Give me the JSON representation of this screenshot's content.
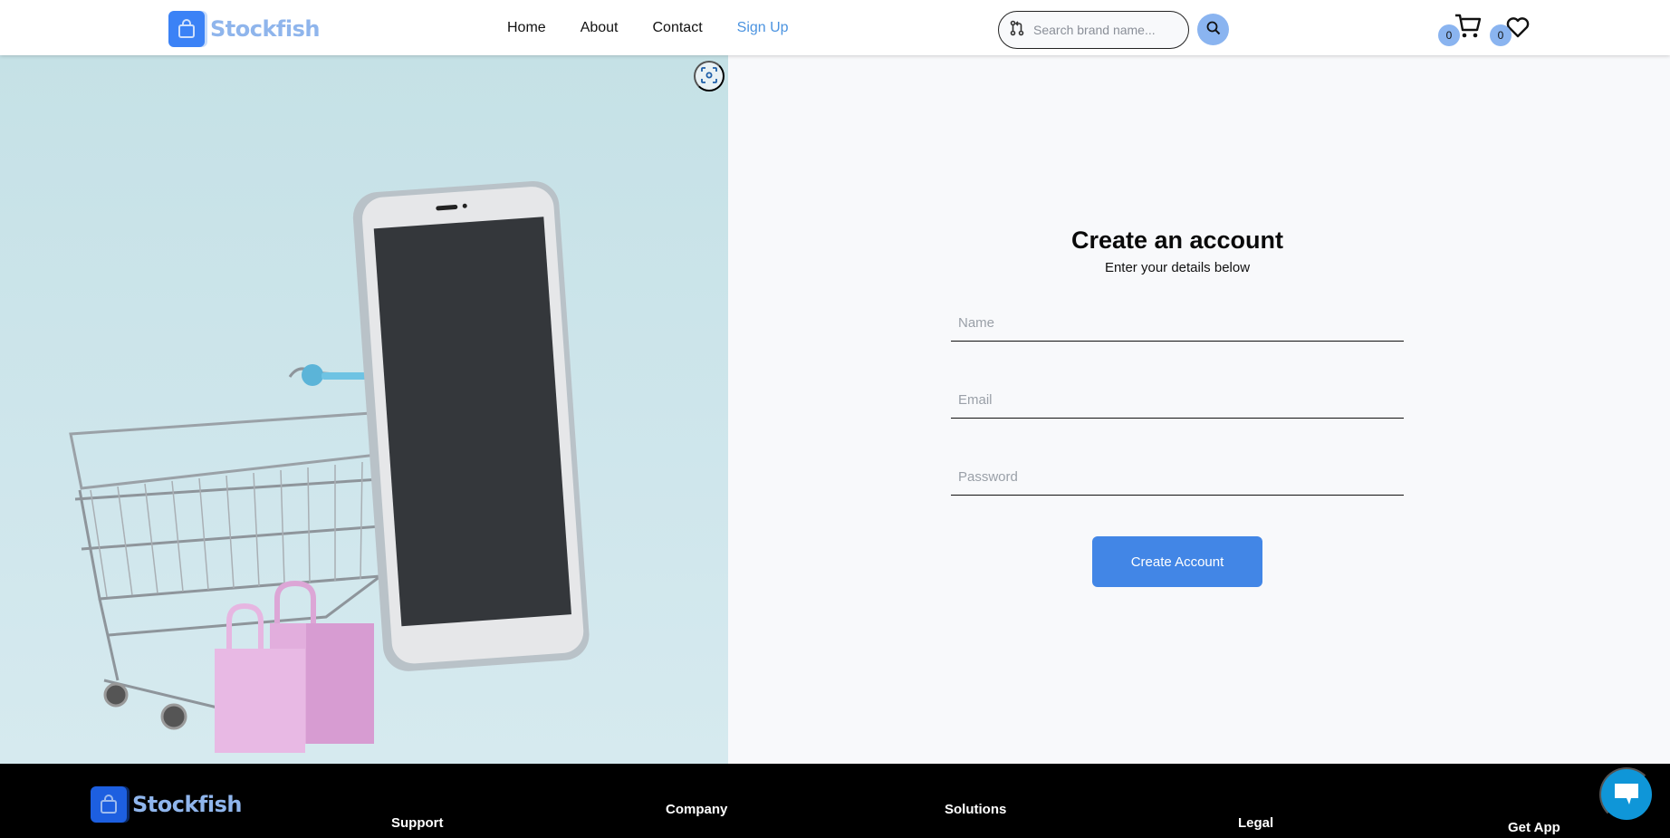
{
  "brand": {
    "name": "Stockfish",
    "accent": "#3b82f6"
  },
  "header": {
    "nav": [
      {
        "label": "Home",
        "active": false
      },
      {
        "label": "About",
        "active": false
      },
      {
        "label": "Contact",
        "active": false
      },
      {
        "label": "Sign Up",
        "active": true
      }
    ],
    "search": {
      "placeholder": "Search brand name...",
      "value": ""
    },
    "cart_count": "0",
    "wishlist_count": "0"
  },
  "hero": {
    "image_alt": "Shopping cart with smartphone and pink shopping bags"
  },
  "form": {
    "title": "Create an account",
    "subtitle": "Enter your details below",
    "name_placeholder": "Name",
    "email_placeholder": "Email",
    "password_placeholder": "Password",
    "submit_label": "Create Account",
    "button_color": "#4286e6"
  },
  "footer": {
    "brand": "Stockfish",
    "columns": [
      "Support",
      "Company",
      "Solutions",
      "Legal",
      "Get App"
    ]
  }
}
